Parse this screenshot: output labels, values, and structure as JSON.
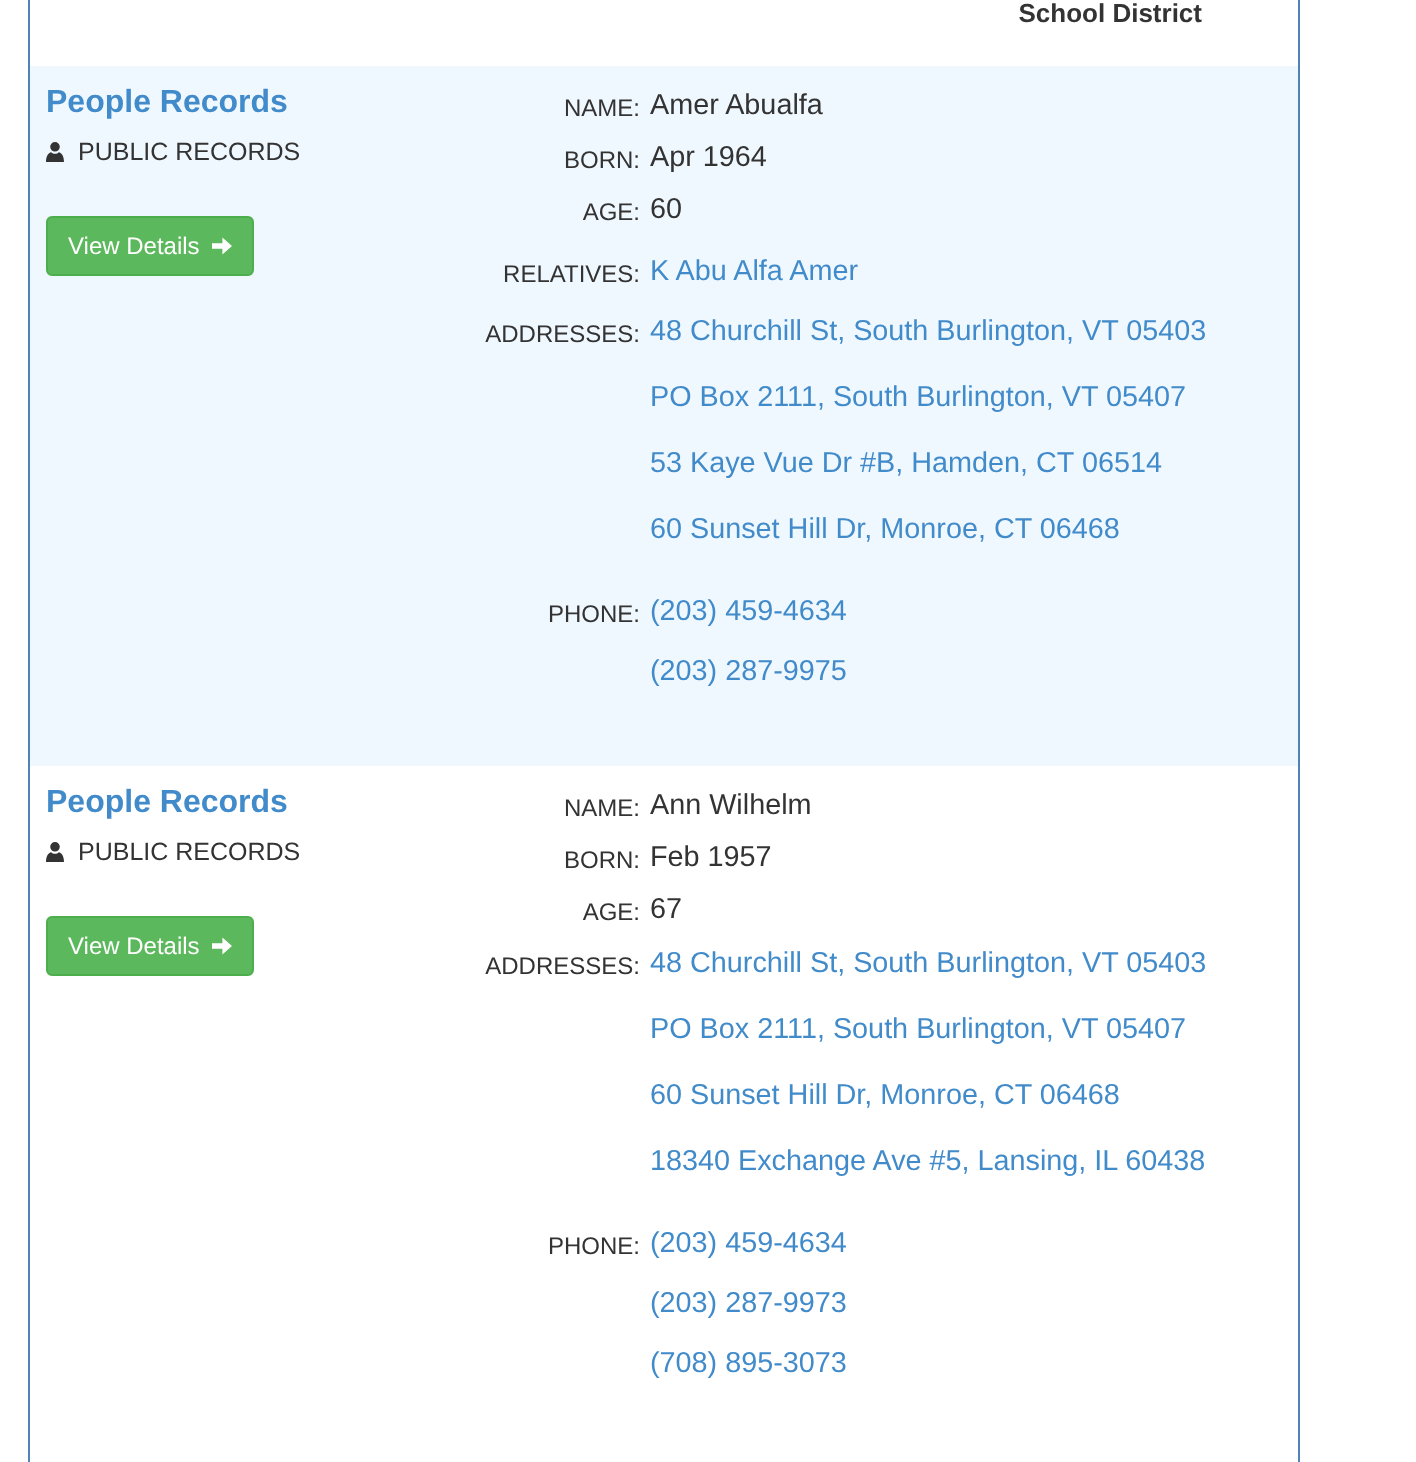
{
  "header": {
    "district": "School District"
  },
  "records": [
    {
      "shaded": true,
      "title": "People Records",
      "source": "PUBLIC RECORDS",
      "button": "View Details",
      "fields": [
        {
          "label": "NAME:",
          "kind": "text",
          "values": [
            "Amer Abualfa"
          ]
        },
        {
          "label": "BORN:",
          "kind": "text",
          "values": [
            "Apr 1964"
          ]
        },
        {
          "label": "AGE:",
          "kind": "text",
          "values": [
            "60"
          ]
        },
        {
          "label": "RELATIVES:",
          "kind": "relative",
          "values": [
            "K Abu Alfa Amer"
          ]
        },
        {
          "label": "ADDRESSES:",
          "kind": "address",
          "values": [
            "48 Churchill St, South Burlington, VT 05403",
            "PO Box 2111, South Burlington, VT 05407",
            "53 Kaye Vue Dr #B, Hamden, CT 06514",
            "60 Sunset Hill Dr, Monroe, CT 06468"
          ]
        },
        {
          "label": "PHONE:",
          "kind": "phone",
          "values": [
            "(203) 459-4634",
            "(203) 287-9975"
          ]
        }
      ]
    },
    {
      "shaded": false,
      "title": "People Records",
      "source": "PUBLIC RECORDS",
      "button": "View Details",
      "fields": [
        {
          "label": "NAME:",
          "kind": "text",
          "values": [
            "Ann Wilhelm"
          ]
        },
        {
          "label": "BORN:",
          "kind": "text",
          "values": [
            "Feb 1957"
          ]
        },
        {
          "label": "AGE:",
          "kind": "text",
          "values": [
            "67"
          ]
        },
        {
          "label": "ADDRESSES:",
          "kind": "address",
          "values": [
            "48 Churchill St, South Burlington, VT 05403",
            "PO Box 2111, South Burlington, VT 05407",
            "60 Sunset Hill Dr, Monroe, CT 06468",
            "18340 Exchange Ave #5, Lansing, IL 60438"
          ]
        },
        {
          "label": "PHONE:",
          "kind": "phone",
          "values": [
            "(203) 459-4634",
            "(203) 287-9973",
            "(708) 895-3073"
          ]
        }
      ]
    }
  ]
}
